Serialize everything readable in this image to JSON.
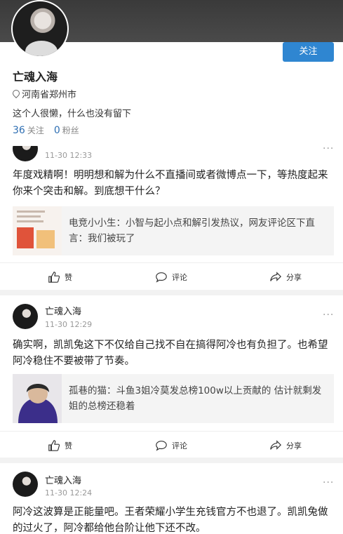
{
  "profile": {
    "name": "亡魂入海",
    "location": "河南省郑州市",
    "bio": "这个人很懒，什么也没有留下",
    "following_count": "36",
    "following_label": "关注",
    "followers_count": "0",
    "followers_label": "粉丝",
    "follow_button": "关注"
  },
  "posts": [
    {
      "author": "",
      "time": "11-30 12:33",
      "text": "年度戏精啊！明明想和解为什么不直播间或者微博点一下，等热度起来你来个突击和解。到底想干什么？",
      "quote": "电竞小小生：小智与起小点和解引发热议，网友评论区下直言：我们被玩了"
    },
    {
      "author": "亡魂入海",
      "time": "11-30 12:29",
      "text": "确实啊，凯凯兔这下不仅给自己找不自在搞得阿冷也有负担了。也希望阿冷稳住不要被带了节奏。",
      "quote": "孤巷的猫：斗鱼3姐冷莫发总榜100w以上贡献的 估计就剩发姐的总榜还稳着"
    },
    {
      "author": "亡魂入海",
      "time": "11-30 12:24",
      "text": "阿冷这波算是正能量吧。王者荣耀小学生充钱官方不也退了。凯凯兔做的过火了，阿冷都给他台阶让他下还不改。"
    }
  ],
  "actions": {
    "like": "赞",
    "comment": "评论",
    "share": "分享"
  },
  "more_glyph": "···"
}
